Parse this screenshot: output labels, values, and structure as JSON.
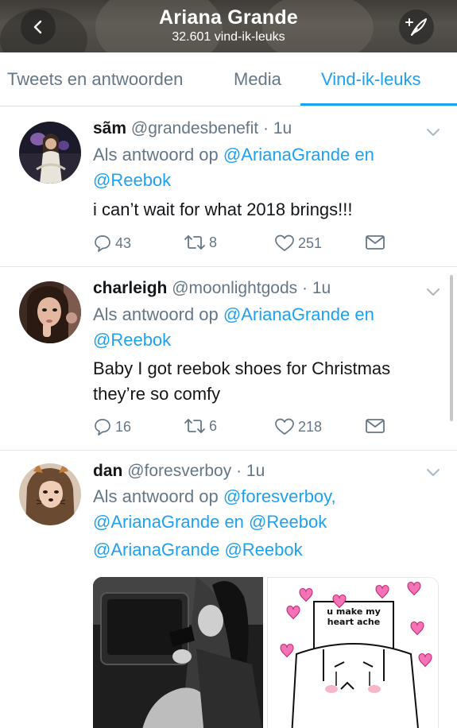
{
  "header": {
    "title": "Ariana Grande",
    "subtitle": "32.601 vind-ik-leuks"
  },
  "tabs": [
    {
      "label": "Tweets en antwoorden"
    },
    {
      "label": "Media"
    },
    {
      "label": "Vind-ik-leuks",
      "active": true
    }
  ],
  "colors": {
    "accent": "#1da1f2",
    "secondary_text": "#657786",
    "primary_text": "#14171a"
  },
  "tweets": [
    {
      "name": "sãm",
      "handle": "@grandesbenefit",
      "dot": "·",
      "time": "1u",
      "reply_prefix": "Als antwoord op",
      "mention1": "@ArianaGrande",
      "joiner": "en",
      "mention2": "@Reebok",
      "text": "i can’t wait for what 2018 brings!!!",
      "replies": "43",
      "retweets": "8",
      "likes": "251"
    },
    {
      "name": "charleigh",
      "handle": "@moonlightgods",
      "dot": "·",
      "time": "1u",
      "reply_prefix": "Als antwoord op",
      "mention1": "@ArianaGrande",
      "joiner": "en",
      "mention2": "@Reebok",
      "text_line1": "Baby I got reebok shoes for Christmas",
      "text_line2": "they’re so comfy",
      "replies": "16",
      "retweets": "6",
      "likes": "218"
    },
    {
      "name": "dan",
      "handle": "@foresverboy",
      "dot": "·",
      "time": "1u",
      "reply_prefix": "Als antwoord op",
      "mention1": "@foresverboy,",
      "mention2": "@ArianaGrande",
      "joiner": "en",
      "mention3": "@Reebok",
      "body_mention1": "@ArianaGrande",
      "body_mention2": "@Reebok",
      "meme_text": "u make my heart ache"
    }
  ],
  "icons": [
    "back-arrow-icon",
    "compose-icon",
    "chevron-down-icon",
    "reply-icon",
    "retweet-icon",
    "heart-icon",
    "message-icon"
  ]
}
